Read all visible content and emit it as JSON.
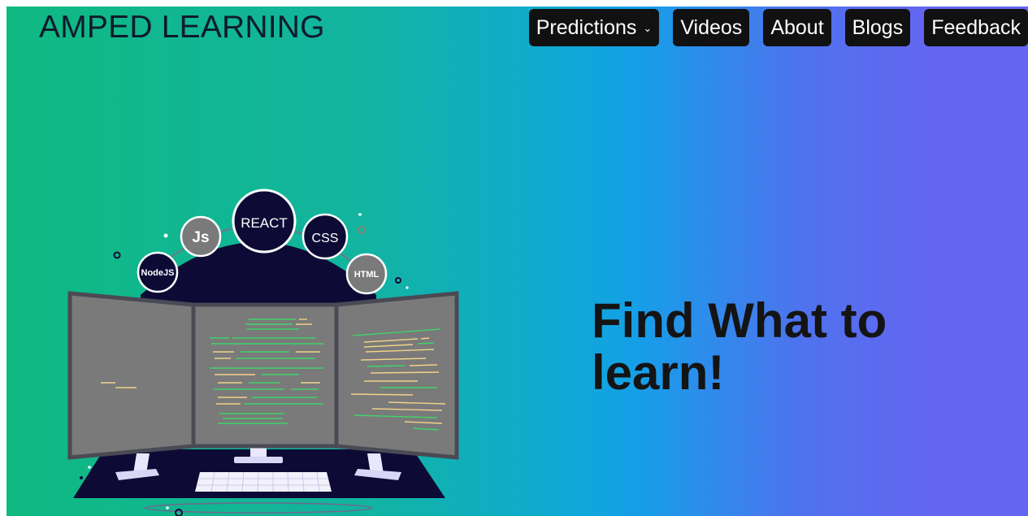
{
  "header": {
    "brand": "AMPED LEARNING",
    "nav": [
      {
        "label": "Predictions",
        "has_dropdown": true
      },
      {
        "label": "Videos"
      },
      {
        "label": "About"
      },
      {
        "label": "Blogs"
      },
      {
        "label": "Feedback"
      }
    ]
  },
  "hero": {
    "title": "Find What to learn!"
  },
  "illustration": {
    "bubbles": [
      "NodeJS",
      "Js",
      "REACT",
      "CSS",
      "HTML"
    ]
  },
  "colors": {
    "gradient_start": "#10b981",
    "gradient_mid": "#169ee8",
    "gradient_end": "#6366f1",
    "nav_bg": "#111111",
    "illus_dark": "#0d0b36"
  }
}
